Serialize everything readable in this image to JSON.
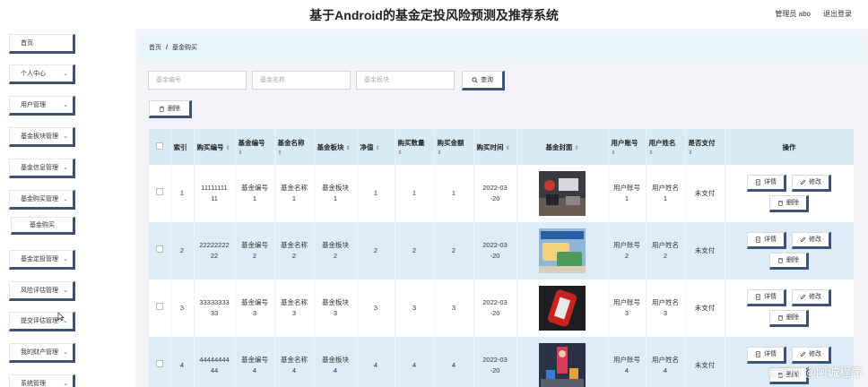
{
  "app": {
    "title": "基于Android的基金定投风险预测及推荐系统",
    "user_label": "管理员 abo",
    "logout_label": "退出登录"
  },
  "sidebar": {
    "items": [
      {
        "label": "首页",
        "has_chevron": false
      },
      {
        "label": "个人中心",
        "has_chevron": true
      },
      {
        "label": "用户管理",
        "has_chevron": true
      },
      {
        "label": "基金板块管理",
        "has_chevron": true
      },
      {
        "label": "基金信息管理",
        "has_chevron": true
      },
      {
        "label": "基金购买管理",
        "has_chevron": true
      },
      {
        "label": "基金购买",
        "sub": true
      },
      {
        "label": "基金定投管理",
        "has_chevron": true
      },
      {
        "label": "风险评估管理",
        "has_chevron": true
      },
      {
        "label": "提交评估管理",
        "has_chevron": true
      },
      {
        "label": "我的财产管理",
        "has_chevron": true
      },
      {
        "label": "系统管理",
        "has_chevron": true
      }
    ]
  },
  "breadcrumb": {
    "home": "首页",
    "separator": "/",
    "current": "基金购买"
  },
  "search": {
    "fund_code_placeholder": "基金编号",
    "fund_name_placeholder": "基金名称",
    "fund_sector_placeholder": "基金板块",
    "query_label": "查询"
  },
  "toolbar": {
    "delete_label": "删除"
  },
  "table": {
    "headers": [
      "索引",
      "购买编号",
      "基金编号",
      "基金名称",
      "基金板块",
      "净值",
      "购买数量",
      "购买金额",
      "购买时间",
      "基金封面",
      "用户账号",
      "用户姓名",
      "是否支付",
      "操作"
    ],
    "rows": [
      {
        "index": "1",
        "purchase_no": "1111111111",
        "fund_code": "基金编号1",
        "fund_name": "基金名称1",
        "fund_sector": "基金板块1",
        "nav": "1",
        "qty": "1",
        "amount": "1",
        "time": "2022-03-20",
        "user_account": "用户账号1",
        "user_name": "用户姓名1",
        "paid": "未支付",
        "cover": "bank-counter"
      },
      {
        "index": "2",
        "purchase_no": "2222222222",
        "fund_code": "基金编号2",
        "fund_name": "基金名称2",
        "fund_sector": "基金板块2",
        "nav": "2",
        "qty": "2",
        "amount": "2",
        "time": "2022-03-20",
        "user_account": "用户账号2",
        "user_name": "用户姓名2",
        "paid": "未支付",
        "cover": "bank-card"
      },
      {
        "index": "3",
        "purchase_no": "3333333333",
        "fund_code": "基金编号3",
        "fund_name": "基金名称3",
        "fund_sector": "基金板块3",
        "nav": "3",
        "qty": "3",
        "amount": "3",
        "time": "2022-03-20",
        "user_account": "用户账号3",
        "user_name": "用户姓名3",
        "paid": "未支付",
        "cover": "bank-sign"
      },
      {
        "index": "4",
        "purchase_no": "4444444444",
        "fund_code": "基金编号4",
        "fund_name": "基金名称4",
        "fund_sector": "基金板块4",
        "nav": "4",
        "qty": "4",
        "amount": "4",
        "time": "2022-03-20",
        "user_account": "用户账号4",
        "user_name": "用户姓名4",
        "paid": "未支付",
        "cover": "finance-people"
      }
    ],
    "actions": {
      "detail_label": "详情",
      "edit_label": "修改",
      "delete_label": "删除"
    }
  },
  "watermark": "CSDN @阿诚程序",
  "colors": {
    "header_bg": "#d7ebf7",
    "row_alt_bg": "#dcedf8",
    "button_shadow": "#3e5278",
    "breadcrumb_bg": "#e8f4fb"
  }
}
